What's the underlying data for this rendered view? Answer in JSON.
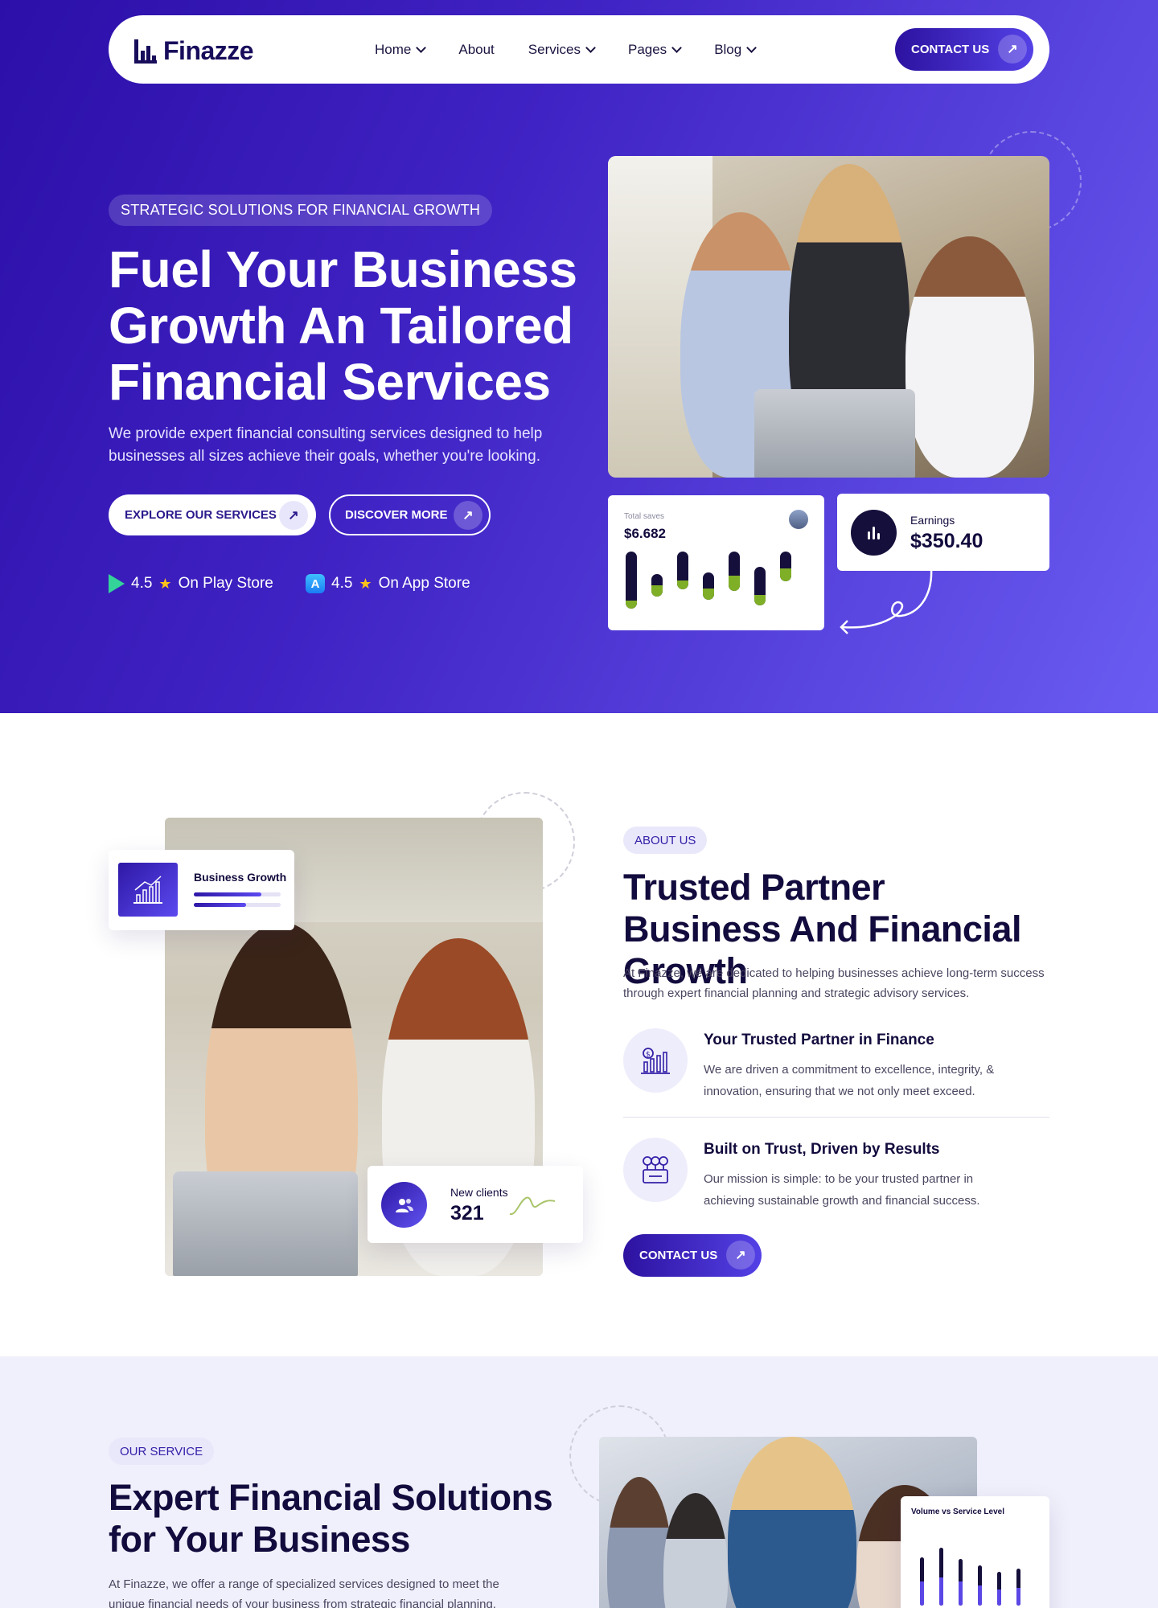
{
  "nav": {
    "logo": "Finazze",
    "items": [
      {
        "label": "Home",
        "dropdown": true
      },
      {
        "label": "About",
        "dropdown": false
      },
      {
        "label": "Services",
        "dropdown": true
      },
      {
        "label": "Pages",
        "dropdown": true
      },
      {
        "label": "Blog",
        "dropdown": true
      }
    ],
    "cta": "CONTACT US"
  },
  "hero": {
    "tag": "STRATEGIC SOLUTIONS FOR FINANCIAL GROWTH",
    "title": "Fuel Your Business Growth An Tailored Financial Services",
    "description": "We provide expert financial consulting services designed to help businesses all sizes achieve their goals, whether you're looking.",
    "btn_primary": "EXPLORE OUR SERVICES",
    "btn_secondary": "DISCOVER MORE",
    "ratings": [
      {
        "score": "4.5",
        "store": "On Play Store",
        "icon": "play-store-icon"
      },
      {
        "score": "4.5",
        "store": "On App Store",
        "icon": "app-store-icon"
      }
    ],
    "saves_card": {
      "label": "Total saves",
      "value": "$6.682",
      "bars": [
        {
          "total": 0.83,
          "green": 0.12
        },
        {
          "total": 0.33,
          "green": 0.16
        },
        {
          "total": 0.55,
          "green": 0.13
        },
        {
          "total": 0.4,
          "green": 0.16
        },
        {
          "total": 0.58,
          "green": 0.22
        },
        {
          "total": 0.56,
          "green": 0.15
        },
        {
          "total": 0.44,
          "green": 0.19
        }
      ]
    },
    "earnings_card": {
      "label": "Earnings",
      "value": "$350.40"
    }
  },
  "about": {
    "pill": "ABOUT US",
    "title": "Trusted Partner Business And Financial Growth",
    "description": "At Finazze, we are dedicated to helping businesses achieve long-term success through expert financial planning and strategic advisory services.",
    "growth_card": {
      "title": "Business Growth",
      "progress": [
        0.78,
        0.6
      ]
    },
    "clients_card": {
      "label": "New clients",
      "value": "321"
    },
    "features": [
      {
        "title": "Your Trusted Partner in Finance",
        "desc": "We are driven a commitment to excellence, integrity, & innovation, ensuring that we not only meet exceed.",
        "icon": "finance-chart-icon"
      },
      {
        "title": "Built on Trust, Driven by Results",
        "desc": "Our mission is simple: to be your trusted partner in achieving sustainable growth and financial success.",
        "icon": "money-growth-icon"
      }
    ],
    "cta": "CONTACT US"
  },
  "service": {
    "pill": "OUR SERVICE",
    "title": "Expert Financial Solutions for Your Business",
    "description": "At Finazze, we offer a range of specialized services designed to meet the unique financial needs of your business from strategic financial planning.",
    "volume_card": {
      "title": "Volume vs Service Level",
      "bars": [
        {
          "total": 0.6,
          "accent": 0.3
        },
        {
          "total": 0.72,
          "accent": 0.35
        },
        {
          "total": 0.58,
          "accent": 0.3
        },
        {
          "total": 0.5,
          "accent": 0.25
        },
        {
          "total": 0.42,
          "accent": 0.2
        },
        {
          "total": 0.46,
          "accent": 0.22
        }
      ]
    }
  },
  "colors": {
    "primary": "#2d12a0",
    "accent": "#5441e6",
    "green": "#7fae27",
    "dark": "#120b3d"
  }
}
